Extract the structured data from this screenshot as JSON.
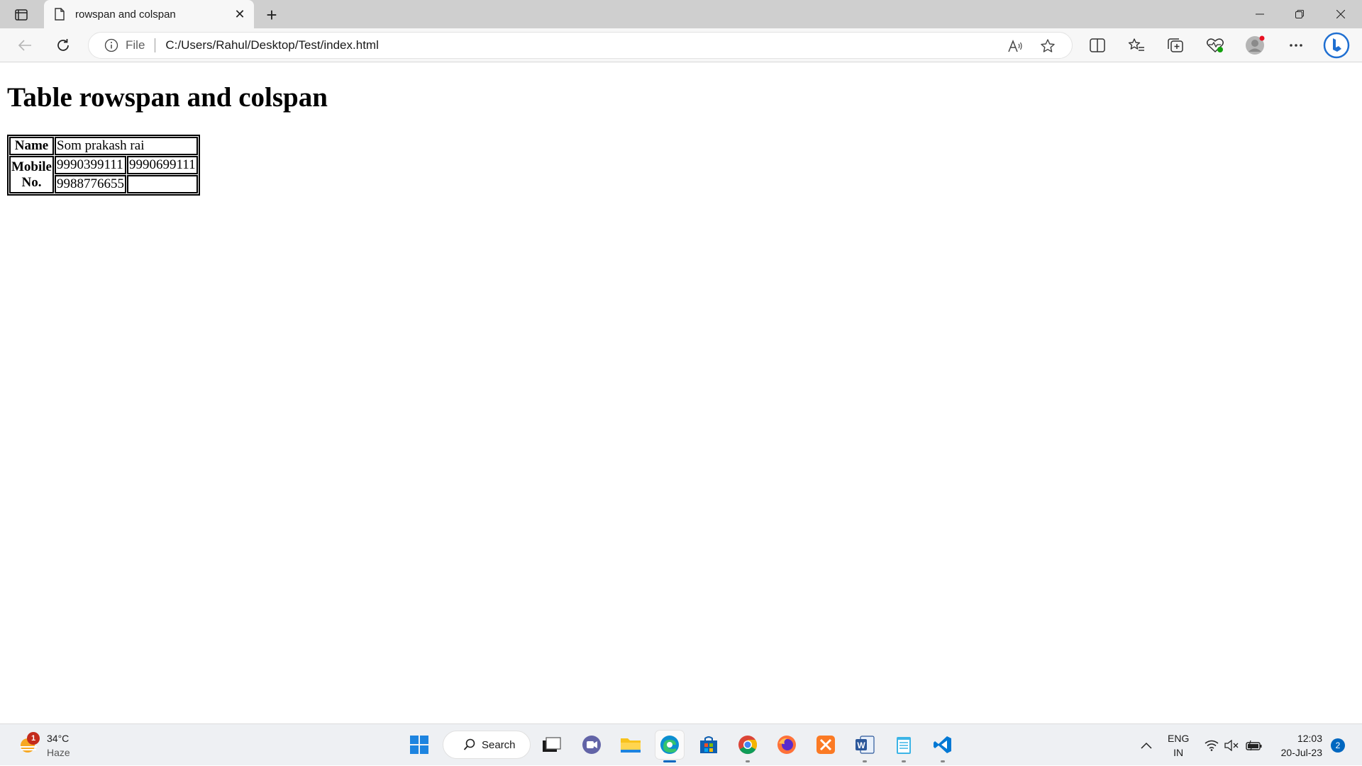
{
  "browser": {
    "tab_title": "rowspan and colspan",
    "close_tab_glyph": "✕",
    "new_tab_glyph": "+",
    "address_scheme_label": "File",
    "address_url": "C:/Users/Rahul/Desktop/Test/index.html"
  },
  "page": {
    "heading": "Table rowspan and colspan",
    "table": {
      "name_header": "Name",
      "name_value": "Som prakash rai",
      "mobile_header_line1": "Mobile",
      "mobile_header_line2": "No.",
      "mobile_row1": [
        "9990399111",
        "9990699111"
      ],
      "mobile_row2": [
        "9988776655",
        ""
      ]
    }
  },
  "taskbar": {
    "weather_temp": "34°C",
    "weather_condition": "Haze",
    "weather_badge": "1",
    "search_label": "Search",
    "lang_line1": "ENG",
    "lang_line2": "IN",
    "time": "12:03",
    "date": "20-Jul-23",
    "notification_count": "2"
  },
  "colors": {
    "accent": "#0067c0",
    "tabbar": "#cfcfcf",
    "toolbar": "#f7f7f7"
  }
}
